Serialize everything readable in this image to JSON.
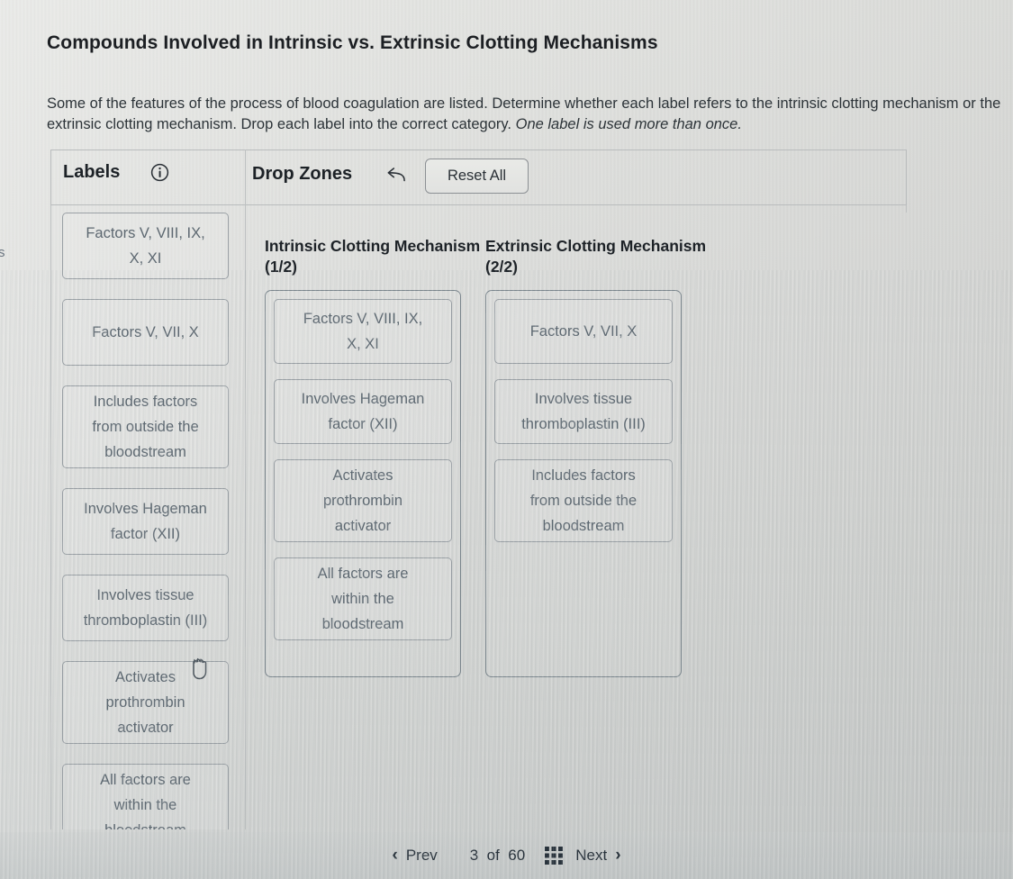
{
  "page": {
    "title": "Compounds Involved in Intrinsic vs. Extrinsic Clotting Mechanisms",
    "instructions_part1": "Some of the features of the process of blood coagulation are listed. Determine whether each label refers to the intrinsic clotting mechanism or the extrinsic clotting mechanism. Drop each label into the correct category. ",
    "instructions_emphasis": "One label is used more than once.",
    "edge_fragment": "s"
  },
  "toolbar": {
    "labels_heading": "Labels",
    "info_icon": "info-circle-icon",
    "dropzones_heading": "Drop Zones",
    "undo_icon": "undo-arrow-icon",
    "reset_label": "Reset All"
  },
  "labels_bank": {
    "items": [
      {
        "lines": [
          "Factors V, VIII, IX,",
          "X, XI"
        ],
        "height": "h2"
      },
      {
        "lines": [
          "Factors V, VII, X"
        ],
        "height": "h1"
      },
      {
        "lines": [
          "Includes factors",
          "from outside the",
          "bloodstream"
        ],
        "height": "h3"
      },
      {
        "lines": [
          "Involves Hageman",
          "factor (XII)"
        ],
        "height": "h2"
      },
      {
        "lines": [
          "Involves tissue",
          "thromboplastin (III)"
        ],
        "height": "h2"
      },
      {
        "lines": [
          "Activates",
          "prothrombin",
          "activator"
        ],
        "height": "h3"
      },
      {
        "lines": [
          "All factors are",
          "within the",
          "bloodstream"
        ],
        "height": "h3"
      }
    ]
  },
  "drop_zones": [
    {
      "title": "Intrinsic Clotting Mechanism (1/2)",
      "items": [
        {
          "lines": [
            "Factors V, VIII, IX,",
            "X, XI"
          ],
          "height": "h2"
        },
        {
          "lines": [
            "Involves Hageman",
            "factor (XII)"
          ],
          "height": "h2"
        },
        {
          "lines": [
            "Activates",
            "prothrombin",
            "activator"
          ],
          "height": "h3"
        },
        {
          "lines": [
            "All factors are",
            "within the",
            "bloodstream"
          ],
          "height": "h3"
        }
      ]
    },
    {
      "title": "Extrinsic Clotting Mechanism (2/2)",
      "items": [
        {
          "lines": [
            "Factors V, VII, X"
          ],
          "height": "h1"
        },
        {
          "lines": [
            "Involves tissue",
            "thromboplastin (III)"
          ],
          "height": "h2"
        },
        {
          "lines": [
            "Includes factors",
            "from outside the",
            "bloodstream"
          ],
          "height": "h3"
        }
      ]
    }
  ],
  "bottom_nav": {
    "prev_label": "Prev",
    "prev_icon": "chevron-left-icon",
    "current_page": "3",
    "of_word": "of",
    "total_pages": "60",
    "count_text": "3  of  60",
    "grid_icon": "grid-menu-icon",
    "next_label": "Next",
    "next_icon": "chevron-right-icon"
  },
  "cursor": {
    "icon": "grab-hand-cursor"
  },
  "colors": {
    "text_primary": "#1d2227",
    "text_muted": "#5d6871",
    "border": "#9aa0a5",
    "background": "#dcdddb"
  }
}
